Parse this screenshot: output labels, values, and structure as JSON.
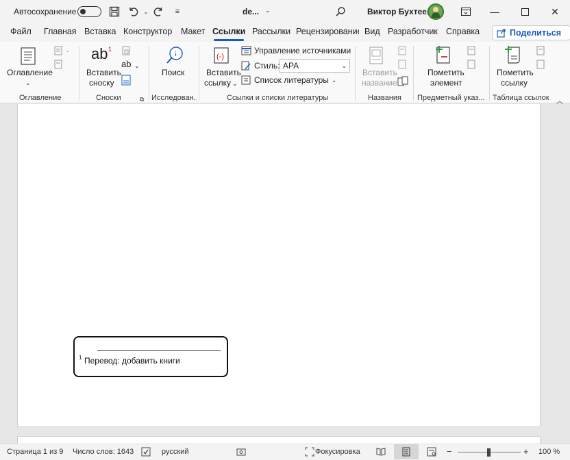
{
  "titlebar": {
    "autosave_label": "Автосохранение",
    "doc_name": "de...",
    "user_name": "Виктор Бухтеев"
  },
  "tabs": [
    {
      "label": "Файл"
    },
    {
      "label": "Главная"
    },
    {
      "label": "Вставка"
    },
    {
      "label": "Конструктор"
    },
    {
      "label": "Макет"
    },
    {
      "label": "Ссылки"
    },
    {
      "label": "Рассылки"
    },
    {
      "label": "Рецензирование"
    },
    {
      "label": "Вид"
    },
    {
      "label": "Разработчик"
    },
    {
      "label": "Справка"
    }
  ],
  "active_tab": "Ссылки",
  "share_label": "Поделиться",
  "ribbon": {
    "toc": {
      "button": "Оглавление",
      "group": "Оглавление"
    },
    "footnotes": {
      "insert_line1": "Вставить",
      "insert_line2": "сноску",
      "group": "Сноски"
    },
    "research": {
      "search": "Поиск",
      "group": "Исследован..."
    },
    "citations": {
      "insert_line1": "Вставить",
      "insert_line2": "ссылку",
      "manage_sources": "Управление источниками",
      "style_label": "Стиль:",
      "style_value": "APA",
      "bibliography": "Список литературы",
      "group": "Ссылки и списки литературы"
    },
    "captions": {
      "insert_line1": "Вставить",
      "insert_line2": "название",
      "group": "Названия"
    },
    "index": {
      "mark_line1": "Пометить",
      "mark_line2": "элемент",
      "group": "Предметный указ..."
    },
    "toa": {
      "mark_line1": "Пометить",
      "mark_line2": "ссылку",
      "group": "Таблица ссылок"
    }
  },
  "document": {
    "footnote_number": "1",
    "footnote_text": "Перевод: добавить книги"
  },
  "statusbar": {
    "page": "Страница 1 из 9",
    "words": "Число слов: 1643",
    "language": "русский",
    "focus": "Фокусировка",
    "zoom": "100 %"
  },
  "colors": {
    "accent": "#185abd",
    "title_bg": "#f3f3f3",
    "canvas": "#e6e6e6"
  }
}
